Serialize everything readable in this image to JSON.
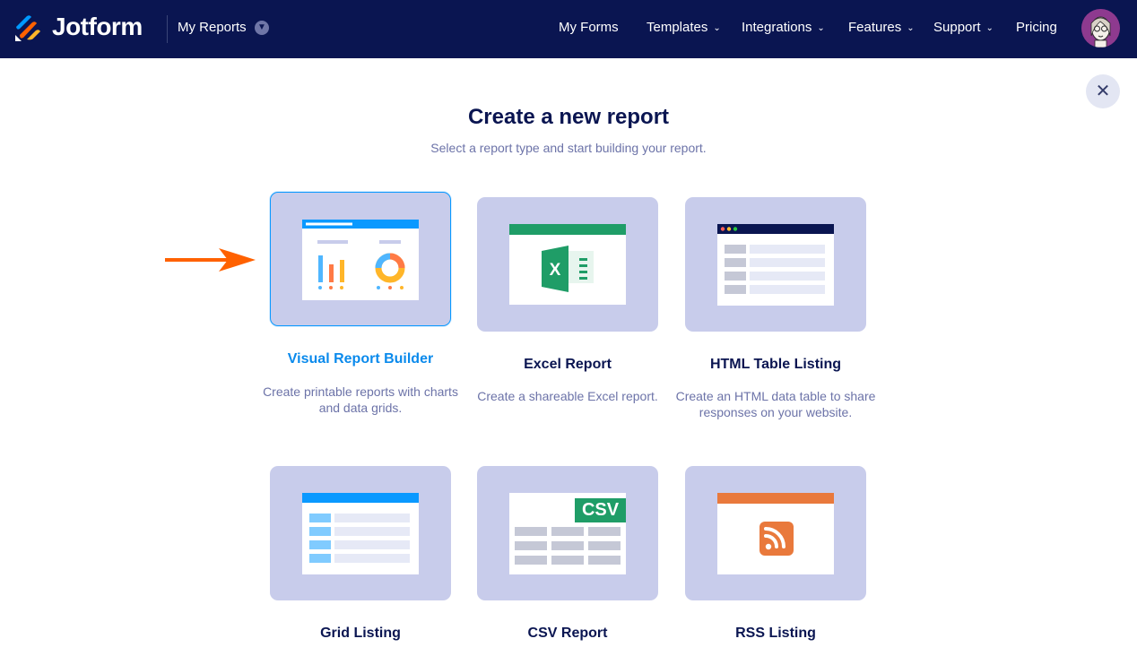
{
  "header": {
    "brand": "Jotform",
    "section": "My Reports",
    "nav": [
      {
        "label": "My Forms",
        "caret": false
      },
      {
        "label": "Templates",
        "caret": true
      },
      {
        "label": "Integrations",
        "caret": true
      },
      {
        "label": "Features",
        "caret": true
      },
      {
        "label": "Support",
        "caret": true
      },
      {
        "label": "Pricing",
        "caret": false
      }
    ],
    "caret_glyph": "⌄"
  },
  "close_glyph": "✕",
  "title": "Create a new report",
  "subtitle": "Select a report type and start building your report.",
  "cards": [
    {
      "title": "Visual Report Builder",
      "desc": "Create printable reports with charts and data grids.",
      "selected": true
    },
    {
      "title": "Excel Report",
      "desc": "Create a shareable Excel report."
    },
    {
      "title": "HTML Table Listing",
      "desc": "Create an HTML data table to share responses on your website."
    },
    {
      "title": "Grid Listing",
      "desc": ""
    },
    {
      "title": "CSV Report",
      "desc": "",
      "badge": "CSV"
    },
    {
      "title": "RSS Listing",
      "desc": ""
    }
  ],
  "colors": {
    "navy": "#0a1551",
    "accent_blue": "#0a99ff",
    "card_bg": "#c8cceb",
    "excel_green": "#1f9d67",
    "rss_orange": "#e9793c",
    "arrow_orange": "#ff6100"
  }
}
